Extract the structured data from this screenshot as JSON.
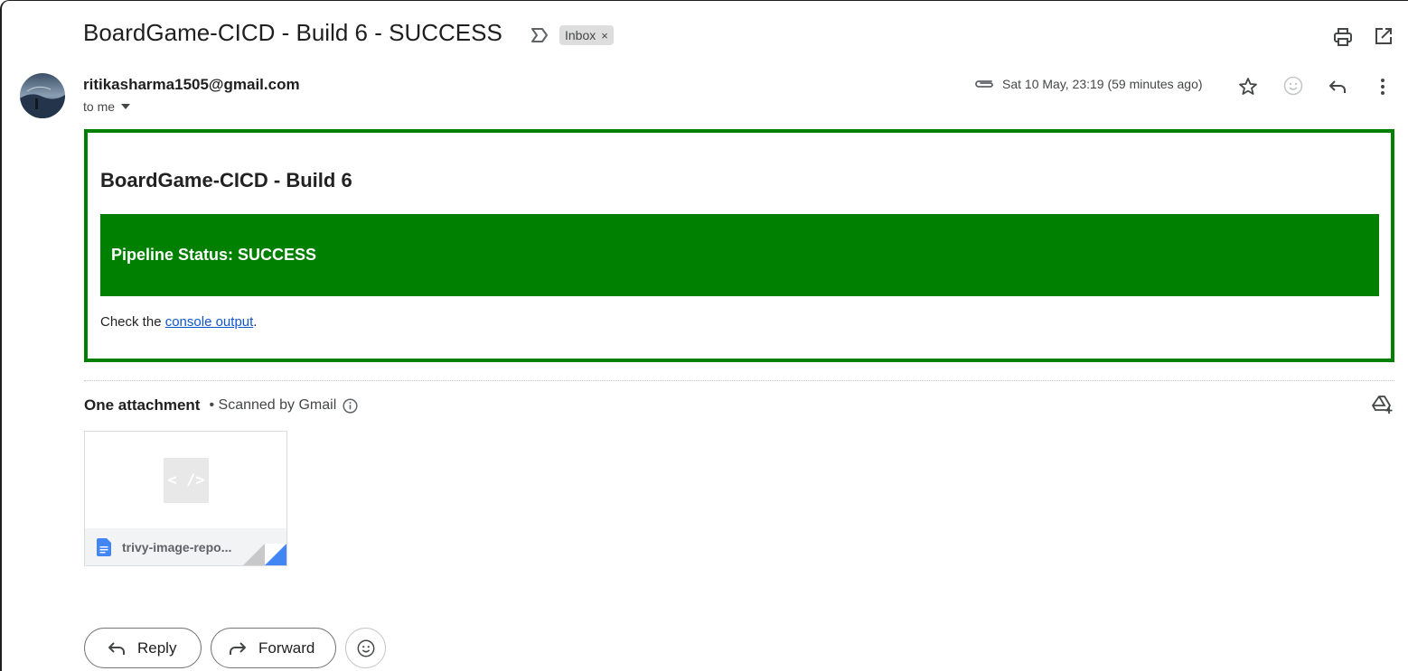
{
  "email": {
    "subject": "BoardGame-CICD - Build 6 - SUCCESS",
    "label_chip": "Inbox",
    "label_remove": "×",
    "sender": "ritikasharma1505@gmail.com",
    "recipient": "to me",
    "date": "Sat 10 May, 23:19 (59 minutes ago)"
  },
  "body": {
    "title": "BoardGame-CICD - Build 6",
    "status": "Pipeline Status: SUCCESS",
    "check_prefix": "Check the ",
    "link_text": "console output",
    "check_suffix": "."
  },
  "attachments": {
    "count_label": "One attachment",
    "scan_label": "• Scanned by Gmail",
    "file_name": "trivy-image-repo...",
    "thumb_glyph": "< />"
  },
  "actions": {
    "reply_label": "Reply",
    "forward_label": "Forward"
  },
  "colors": {
    "status_green": "#008000",
    "link_blue": "#1155cc",
    "doc_blue": "#4285f4"
  },
  "icons": [
    "importance-icon",
    "print-icon",
    "open-new-window-icon",
    "attachment-clip-icon",
    "star-icon",
    "emoji-icon",
    "reply-icon",
    "more-vert-icon",
    "info-icon",
    "add-to-drive-icon",
    "doc-icon",
    "forward-icon"
  ]
}
